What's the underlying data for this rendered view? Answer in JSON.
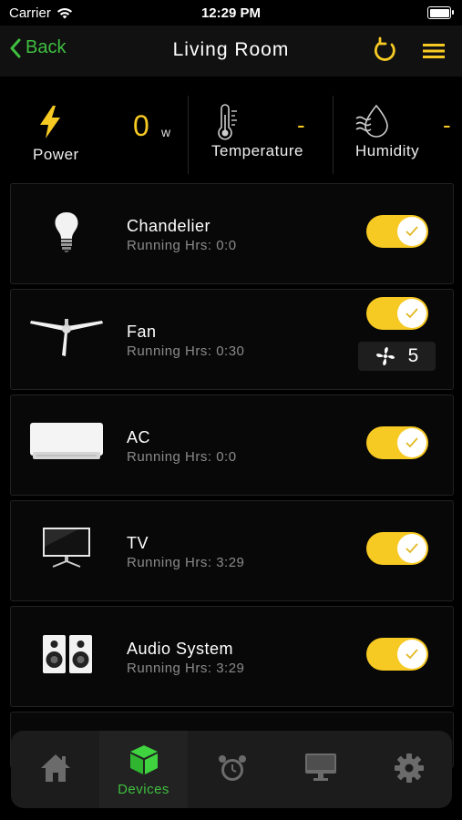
{
  "status_bar": {
    "carrier": "Carrier",
    "time": "12:29 PM"
  },
  "nav": {
    "back_label": "Back",
    "title": "Living Room"
  },
  "stats": {
    "power": {
      "label": "Power",
      "value": "0",
      "unit": "w"
    },
    "temperature": {
      "label": "Temperature",
      "value": "-"
    },
    "humidity": {
      "label": "Humidity",
      "value": "-"
    }
  },
  "devices": [
    {
      "name": "Chandelier",
      "running_hours": "Running Hrs: 0:0",
      "on": true,
      "icon": "light-bulb-icon"
    },
    {
      "name": "Fan",
      "running_hours": "Running Hrs: 0:30",
      "on": true,
      "speed": "5",
      "icon": "ceiling-fan-icon"
    },
    {
      "name": "AC",
      "running_hours": "Running Hrs: 0:0",
      "on": true,
      "icon": "air-conditioner-icon"
    },
    {
      "name": "TV",
      "running_hours": "Running Hrs: 3:29",
      "on": true,
      "icon": "tv-icon"
    },
    {
      "name": "Audio System",
      "running_hours": "Running Hrs: 3:29",
      "on": true,
      "icon": "speakers-icon"
    }
  ],
  "tabbar": {
    "active": "Devices",
    "tabs": [
      {
        "icon": "home-icon"
      },
      {
        "icon": "cube-icon",
        "label": "Devices"
      },
      {
        "icon": "alarm-clock-icon"
      },
      {
        "icon": "monitor-icon"
      },
      {
        "icon": "gear-icon"
      }
    ]
  },
  "colors": {
    "accent_yellow": "#f7c923",
    "accent_green": "#3fbf3f",
    "background": "#000000"
  }
}
